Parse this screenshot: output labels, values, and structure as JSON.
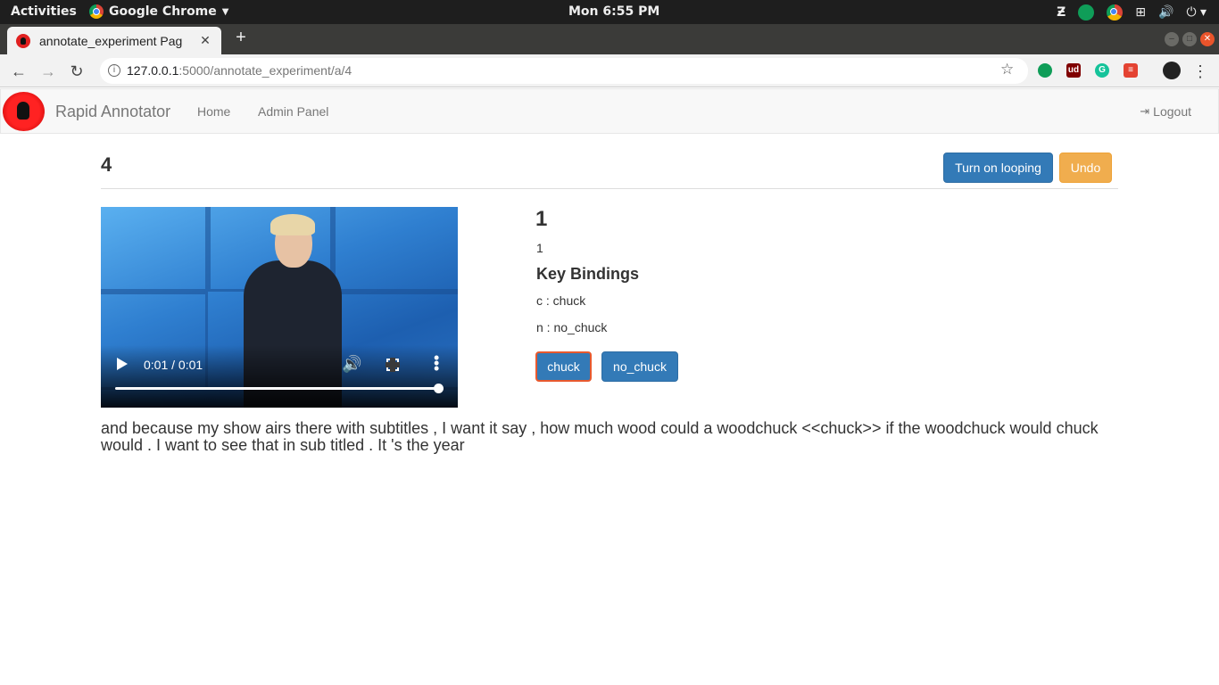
{
  "system_bar": {
    "activities": "Activities",
    "app_name": "Google Chrome",
    "clock": "Mon  6:55 PM"
  },
  "browser": {
    "tab_title": "annotate_experiment Pag",
    "url_host": "127.0.0.1",
    "url_path": ":5000/annotate_experiment/a/4"
  },
  "app": {
    "brand": "Rapid Annotator",
    "nav": {
      "home": "Home",
      "admin": "Admin Panel",
      "logout": "Logout"
    }
  },
  "page": {
    "heading": "4",
    "buttons": {
      "loop": "Turn on looping",
      "undo": "Undo"
    },
    "video": {
      "time": "0:01 / 0:01",
      "progress": 1.0
    },
    "label_number": "1",
    "label_sub": "1",
    "key_bindings_title": "Key Bindings",
    "key_bindings": [
      "c : chuck",
      "n : no_chuck"
    ],
    "label_buttons": [
      "chuck",
      "no_chuck"
    ],
    "transcript": "and because my show airs there with subtitles , I want it say , how much wood could a woodchuck <<chuck>> if the woodchuck would chuck would . I want to see that in sub titled . It 's the year"
  },
  "colors": {
    "primary": "#337ab7",
    "warning": "#f0ad4e",
    "selected_border": "#e8592e"
  }
}
